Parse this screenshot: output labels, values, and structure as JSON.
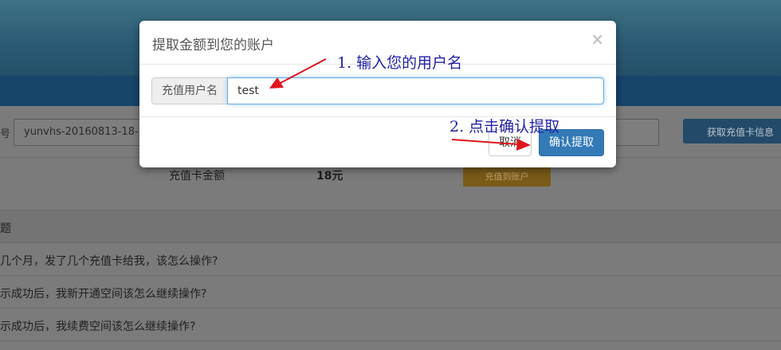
{
  "background": {
    "card_label_fragment": "号",
    "card_number_value": "yunvhs-20160813-18-7",
    "fetch_button_label": "获取充值卡信息",
    "amount_label": "充值卡金额",
    "amount_value": "18元",
    "recharge_button_label": "充值到账户",
    "faq_header": "题",
    "faq_items": [
      "几个月，发了几个充值卡给我，该怎么操作?",
      "示成功后，我新开通空间该怎么继续操作?",
      "示成功后，我续费空间该怎么继续操作?"
    ]
  },
  "modal": {
    "title": "提取金额到您的账户",
    "close_symbol": "×",
    "username_label": "充值用户名",
    "username_value": "test",
    "cancel_label": "取消",
    "confirm_label": "确认提取"
  },
  "annotations": {
    "step1": "1. 输入您的用户名",
    "step2": "2. 点击确认提取",
    "color": "#2323a8",
    "arrow_color": "#e0141c"
  },
  "colors": {
    "primary_button": "#337ab7",
    "recharge_button": "#f0b429",
    "fetch_button": "#3a8ad4"
  }
}
